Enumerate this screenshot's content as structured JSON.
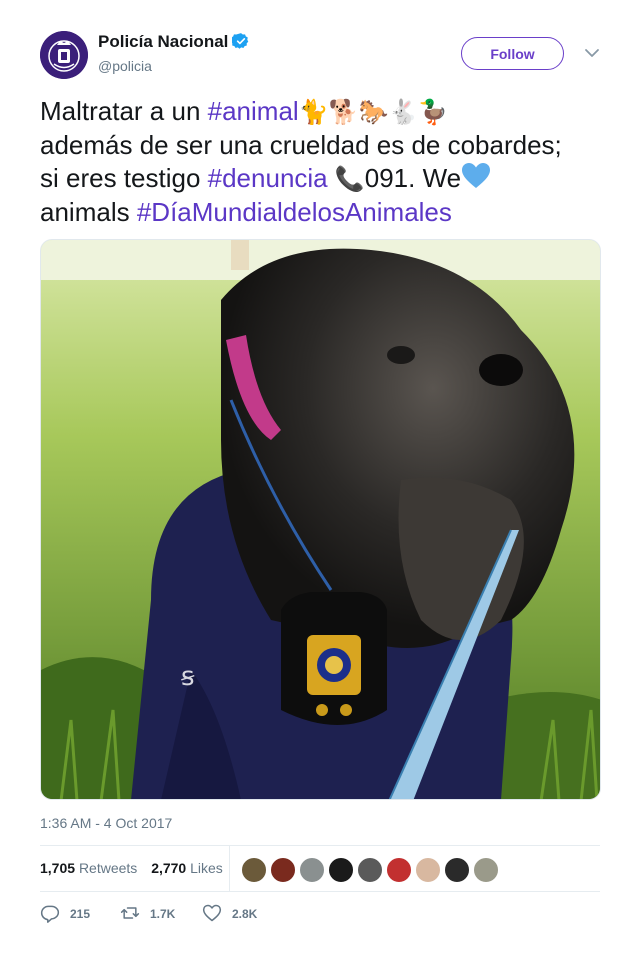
{
  "author": {
    "name": "Policía Nacional",
    "handle": "@policia",
    "verified": true
  },
  "follow_label": "Follow",
  "text": {
    "t1": "Maltratar a un ",
    "tag_animal": "#animal",
    "emojis_animals": "🐈🐕🐎🐇🦆",
    "t2": "además de ser una crueldad es de cobardes;",
    "t3": "si eres testigo ",
    "tag_denuncia": "#denuncia",
    "phone_emoji": "📞",
    "t4": "091. We",
    "t5": "animals ",
    "tag_dia": "#DíaMundialdelosAnimales"
  },
  "timestamp": "1:36 AM - 4 Oct 2017",
  "stats": {
    "retweets_count": "1,705",
    "retweets_label": "Retweets",
    "likes_count": "2,770",
    "likes_label": "Likes"
  },
  "liker_avatar_count": 9,
  "actions": {
    "replies": "215",
    "retweets": "1.7K",
    "likes": "2.8K"
  },
  "colors": {
    "accent": "#5b37c6",
    "verified": "#1da1f2",
    "heart": "#5dadec",
    "muted": "#657786"
  },
  "icons": [
    "verified-badge-icon",
    "chevron-down-icon",
    "reply-icon",
    "retweet-icon",
    "like-icon",
    "blue-heart-icon"
  ]
}
